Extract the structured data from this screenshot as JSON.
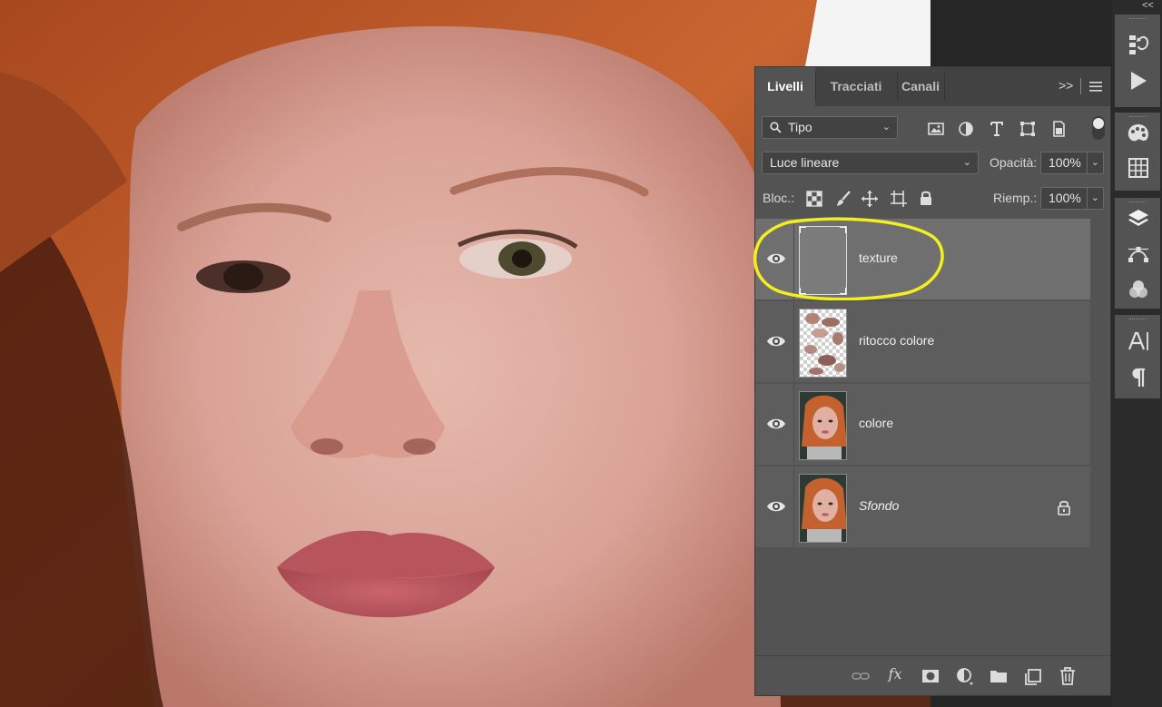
{
  "panel": {
    "tabs": [
      {
        "label": "Livelli",
        "active": true
      },
      {
        "label": "Tracciati",
        "active": false
      },
      {
        "label": "Canali",
        "active": false
      }
    ],
    "expand_label": ">>",
    "filter": {
      "label": "Tipo"
    },
    "blend": {
      "mode": "Luce lineare",
      "opacity_label": "Opacità:",
      "opacity": "100%"
    },
    "lock": {
      "label": "Bloc.:",
      "fill_label": "Riemp.:",
      "fill": "100%"
    },
    "layers": [
      {
        "name": "texture",
        "selected": true,
        "italic": false,
        "locked": false,
        "visible": true,
        "thumb": "gray-fill"
      },
      {
        "name": "ritocco colore",
        "selected": false,
        "italic": false,
        "locked": false,
        "visible": true,
        "thumb": "transparent-patches"
      },
      {
        "name": "colore",
        "selected": false,
        "italic": false,
        "locked": false,
        "visible": true,
        "thumb": "portrait"
      },
      {
        "name": "Sfondo",
        "selected": false,
        "italic": true,
        "locked": true,
        "visible": true,
        "thumb": "portrait"
      }
    ],
    "bottom_icons": [
      "link-icon",
      "fx-icon",
      "mask-icon",
      "adjustment-icon",
      "folder-icon",
      "new-layer-icon",
      "trash-icon"
    ],
    "fx_label": "fx"
  },
  "toolbar": {
    "collapse_label": "<<",
    "icons": [
      "history-icon",
      "play-icon",
      "palette-icon",
      "grid-icon",
      "layers-icon",
      "paths-icon",
      "channels-icon",
      "character-icon",
      "paragraph-icon"
    ]
  },
  "colors": {
    "panel_bg": "#535353",
    "selected_row": "#6f6f6f",
    "highlight": "#f2ee1f",
    "hair": "#c4622f",
    "skin": "#d9a79a"
  }
}
